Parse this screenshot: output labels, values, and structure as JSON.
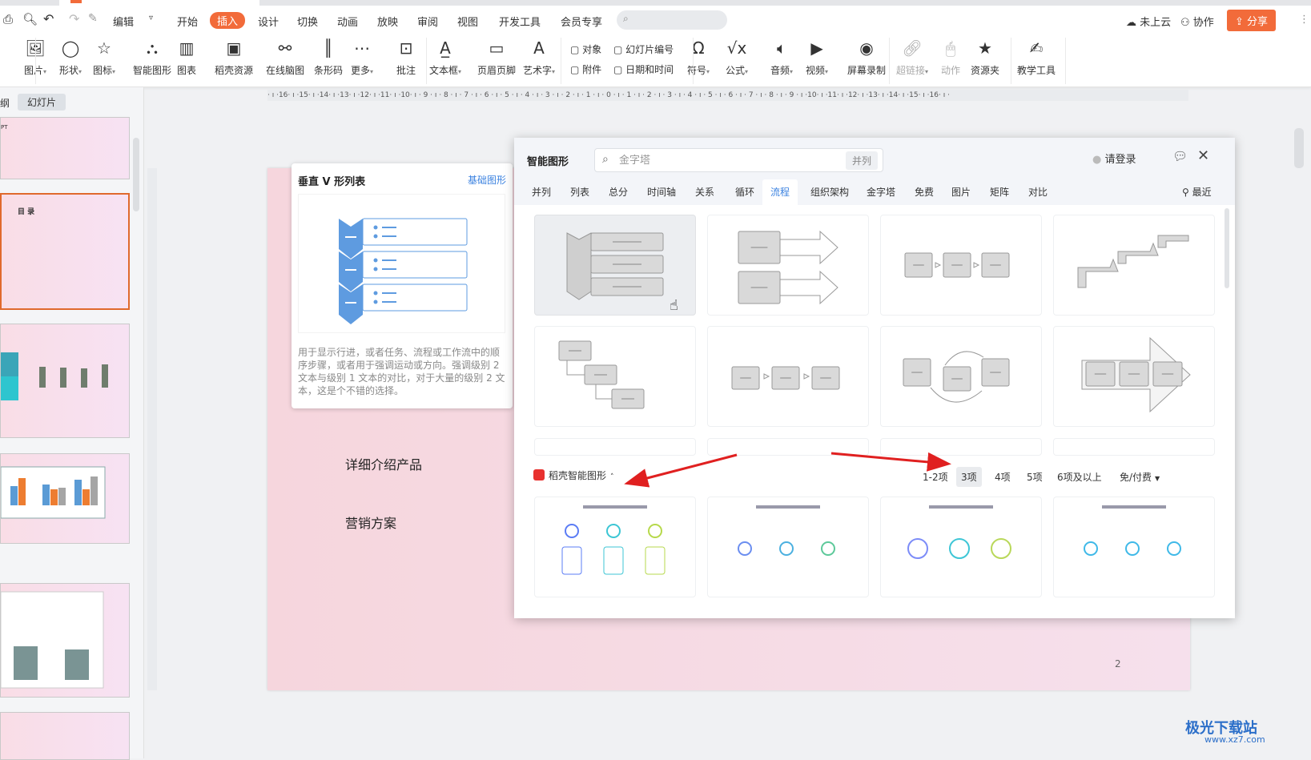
{
  "quickbar": {
    "edit_label": "编辑"
  },
  "menu": [
    "开始",
    "插入",
    "设计",
    "切换",
    "动画",
    "放映",
    "审阅",
    "视图",
    "开发工具",
    "会员专享"
  ],
  "topright": {
    "cloud": "未上云",
    "collab": "协作",
    "share": "分享"
  },
  "ribbon": {
    "items": [
      "图片",
      "形状",
      "图标",
      "智能图形",
      "图表",
      "稻壳资源",
      "在线脑图",
      "条形码",
      "更多",
      "批注",
      "文本框",
      "页眉页脚",
      "艺术字",
      "符号",
      "公式",
      "音频",
      "视频",
      "屏幕录制",
      "超链接",
      "动作",
      "资源夹",
      "教学工具"
    ],
    "small": [
      "对象",
      "附件",
      "幻灯片编号",
      "日期和时间"
    ]
  },
  "ruler": "· ı ·16· ı ·15· ı ·14· ı ·13· ı ·12· ı ·11· ı ·10· ı · 9 · ı · 8 · ı · 7 · ı · 6 · ı · 5 · ı · 4 · ı · 3 · ı · 2 · ı · 1 · ı · 0 · ı · 1 · ı · 2 · ı · 3 · ı · 4 · ı · 5 · ı · 6 · ı · 7 · ı · 8 · ı · 9 · ı ·10· ı ·11· ı ·12· ı ·13· ı ·14· ı ·15· ı ·16· ı ·",
  "leftpanel": {
    "tab_outline": "纲",
    "tab_slides": "幻灯片",
    "thumb1": "PT",
    "thumb2": "目 录"
  },
  "slide": {
    "line1": "详细介绍产品",
    "line2": "营销方案",
    "page": "2"
  },
  "tooltip": {
    "title": "垂直 V 形列表",
    "link": "基础图形",
    "desc": "用于显示行进，或者任务、流程或工作流中的顺序步骤，或者用于强调运动或方向。强调级别 2 文本与级别 1 文本的对比，对于大量的级别 2 文本，这是个不错的选择。"
  },
  "dialog": {
    "title": "智能图形",
    "search_placeholder": "金字塔",
    "search_tag": "并列",
    "login": "请登录",
    "recent": "最近",
    "tabs": [
      "并列",
      "列表",
      "总分",
      "时间轴",
      "关系",
      "循环",
      "流程",
      "组织架构",
      "金字塔",
      "免费",
      "图片",
      "矩阵",
      "对比"
    ],
    "active_tab": "流程",
    "docer_label": "稻壳智能图形",
    "filters": [
      "1-2项",
      "3项",
      "4项",
      "5项",
      "6项及以上"
    ],
    "selected_filter": "3项",
    "price_filter": "免/付费"
  },
  "watermark": {
    "name": "极光下载站",
    "url": "www.xz7.com"
  },
  "colors": {
    "accent": "#f26b3a",
    "link": "#3b82e0",
    "annotation_arrow": "#e02020"
  }
}
